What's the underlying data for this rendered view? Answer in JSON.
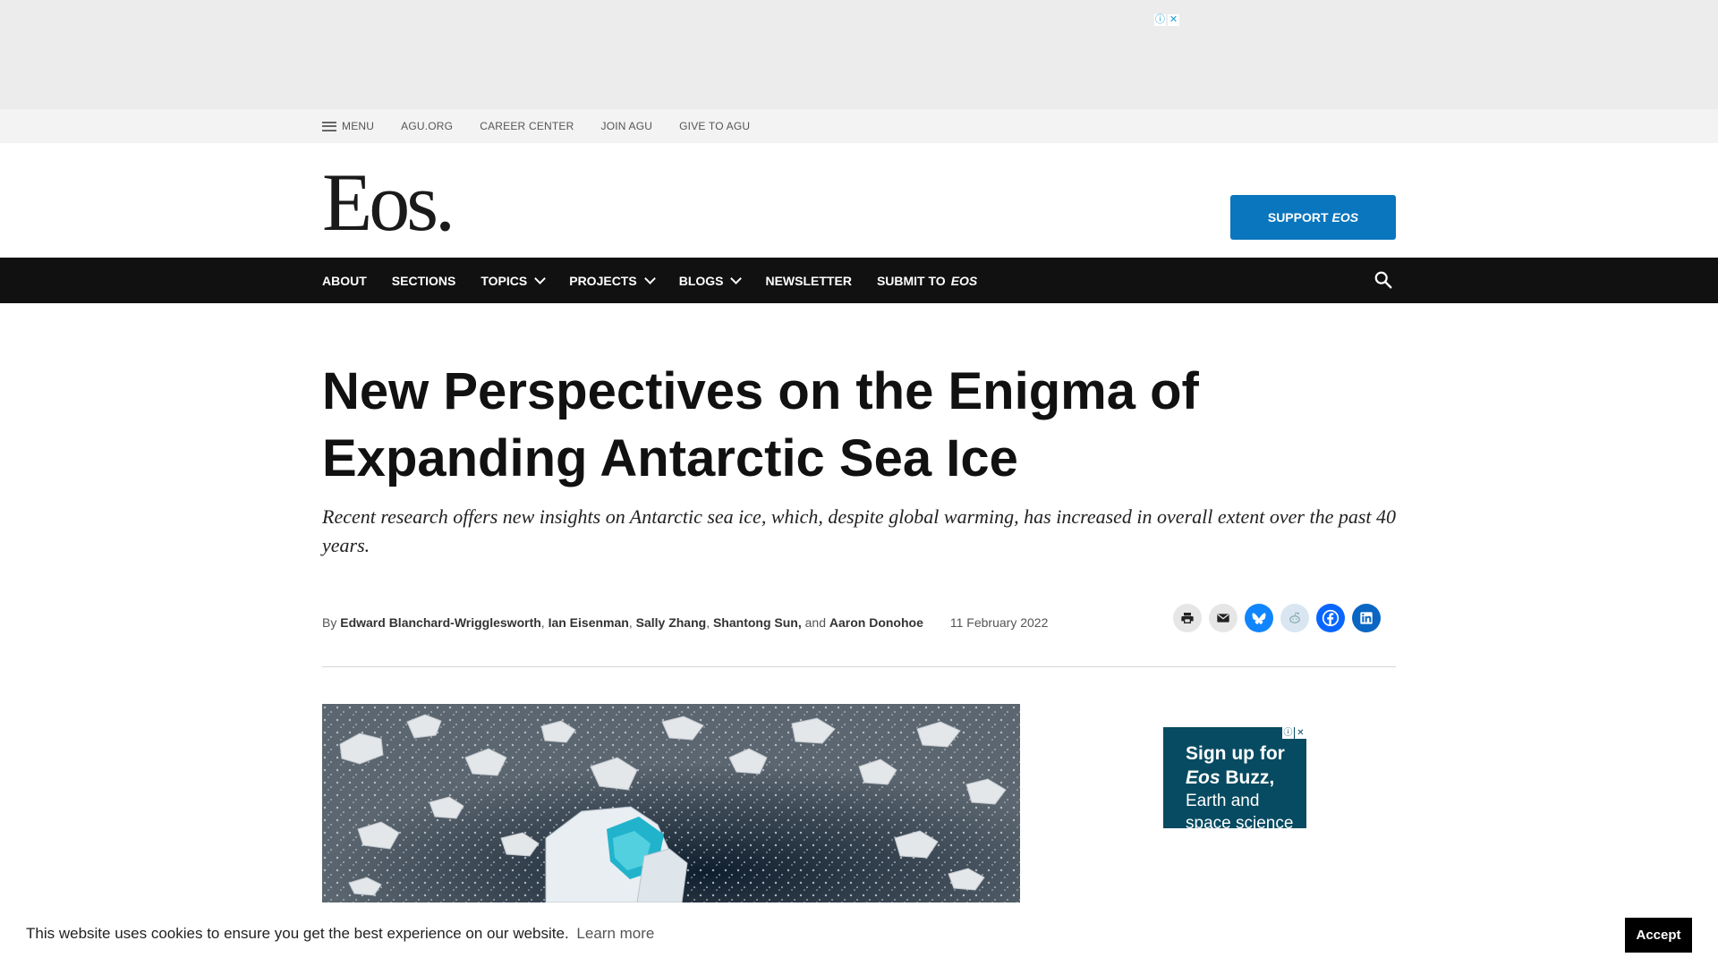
{
  "ad_top": {
    "badge_info": "ⓘ",
    "badge_close": "✕"
  },
  "utility": {
    "menu_label": "MENU",
    "links": [
      "AGU.ORG",
      "CAREER CENTER",
      "JOIN AGU",
      "GIVE TO AGU"
    ]
  },
  "masthead": {
    "logo": "Eos.",
    "support_label": "SUPPORT",
    "support_em": "EOS"
  },
  "nav": {
    "about": "ABOUT",
    "sections": "SECTIONS",
    "topics": "TOPICS",
    "projects": "PROJECTS",
    "blogs": "BLOGS",
    "newsletter": "NEWSLETTER",
    "submit": "SUBMIT TO",
    "submit_em": "EOS"
  },
  "article": {
    "title": "New Perspectives on the Enigma of Expanding Antarctic Sea Ice",
    "subtitle": "Recent research offers new insights on Antarctic sea ice, which, despite global warming, has increased in overall extent over the past 40 years.",
    "by": "By",
    "authors": [
      "Edward Blanchard-Wrigglesworth",
      "Ian Eisenman",
      "Sally Zhang",
      "Shantong Sun,",
      "Aaron Donohoe"
    ],
    "sep_comma": ",",
    "and": "and",
    "date": "11 February 2022"
  },
  "share": {
    "icons": [
      "print-icon",
      "email-icon",
      "bluesky-icon",
      "reddit-icon",
      "facebook-icon",
      "linkedin-icon"
    ],
    "colors": {
      "bluesky": "#1185fe",
      "facebook": "#0866ff",
      "linkedin": "#0a66c2",
      "grey": "#e6e6e6"
    }
  },
  "side_ad": {
    "line1": "Sign up for",
    "line2_em": "Eos",
    "line2": "Buzz,",
    "line3": "Earth and space science",
    "badge_info": "ⓘ",
    "badge_close": "✕"
  },
  "cookie": {
    "message": "This website uses cookies to ensure you get the best experience on our website.",
    "learn_more": "Learn more",
    "accept": "Accept"
  },
  "colors": {
    "accent": "#0a76bd",
    "nav_bg": "#111111",
    "ad_bg": "#064b61"
  }
}
